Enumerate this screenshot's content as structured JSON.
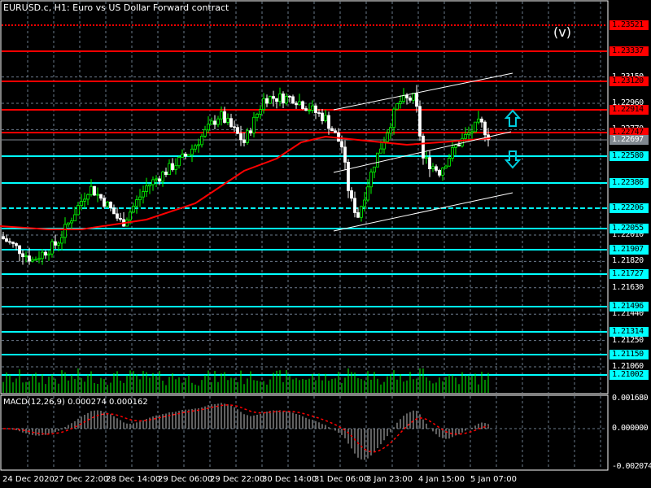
{
  "header": {
    "title": "EURUSD.c, H1:  Euro vs US Dollar Forward contract"
  },
  "marker_label": "(v)",
  "macd": {
    "label": "MACD(12,26,9) 0.000274 0.000162",
    "axis": [
      "0.001680",
      "0.000000",
      "-0.002074"
    ],
    "max": 0.00168,
    "min": -0.002074
  },
  "price_axis": [
    "1.23150",
    "1.22960",
    "1.22770",
    "1.22010",
    "1.21820",
    "1.21630",
    "1.21440",
    "1.21250",
    "1.21060"
  ],
  "levels": [
    {
      "price": "1.23521",
      "color": "#ff0000",
      "style": "dotted"
    },
    {
      "price": "1.23337",
      "color": "#ff0000",
      "style": "solid"
    },
    {
      "price": "1.23120",
      "color": "#ff0000",
      "style": "solid"
    },
    {
      "price": "1.22914",
      "color": "#ff0000",
      "style": "solid"
    },
    {
      "price": "1.22747",
      "color": "#ff0000",
      "style": "solid"
    },
    {
      "price": "1.22697",
      "color": "#808890",
      "style": "solid"
    },
    {
      "price": "1.22580",
      "color": "#00ffff",
      "style": "solid"
    },
    {
      "price": "1.22386",
      "color": "#00ffff",
      "style": "solid"
    },
    {
      "price": "1.22206",
      "color": "#00ffff",
      "style": "dashed"
    },
    {
      "price": "1.22055",
      "color": "#00ffff",
      "style": "solid"
    },
    {
      "price": "1.21907",
      "color": "#00ffff",
      "style": "solid"
    },
    {
      "price": "1.21727",
      "color": "#00ffff",
      "style": "solid"
    },
    {
      "price": "1.21496",
      "color": "#00ffff",
      "style": "solid"
    },
    {
      "price": "1.21314",
      "color": "#00ffff",
      "style": "solid"
    },
    {
      "price": "1.21150",
      "color": "#00ffff",
      "style": "solid"
    },
    {
      "price": "1.21002",
      "color": "#00ffff",
      "style": "solid"
    }
  ],
  "time_axis": [
    "24 Dec 2020",
    "27 Dec 22:00",
    "28 Dec 14:00",
    "29 Dec 06:00",
    "29 Dec 22:00",
    "30 Dec 14:00",
    "31 Dec 06:00",
    "3 Jan 23:00",
    "4 Jan 15:00",
    "5 Jan 07:00"
  ],
  "price_path": [
    [
      0,
      1.22
    ],
    [
      20,
      1.2192
    ],
    [
      40,
      1.2183
    ],
    [
      70,
      1.2195
    ],
    [
      110,
      1.2236
    ],
    [
      130,
      1.2224
    ],
    [
      150,
      1.2209
    ],
    [
      180,
      1.2236
    ],
    [
      230,
      1.2259
    ],
    [
      270,
      1.2288
    ],
    [
      300,
      1.2268
    ],
    [
      325,
      1.23
    ],
    [
      360,
      1.23
    ],
    [
      400,
      1.2285
    ],
    [
      420,
      1.2265
    ],
    [
      430,
      1.2227
    ],
    [
      440,
      1.2215
    ],
    [
      460,
      1.2253
    ],
    [
      490,
      1.2297
    ],
    [
      510,
      1.23
    ],
    [
      520,
      1.2256
    ],
    [
      540,
      1.2247
    ],
    [
      560,
      1.2265
    ],
    [
      590,
      1.2282
    ],
    [
      603,
      1.227
    ]
  ],
  "colors": {
    "bull": "#00ff00",
    "bear": "#ffffff",
    "ma": "#ff0000",
    "grid": "#6d7b8d",
    "resistance": "#ff0000",
    "support": "#00ffff"
  }
}
